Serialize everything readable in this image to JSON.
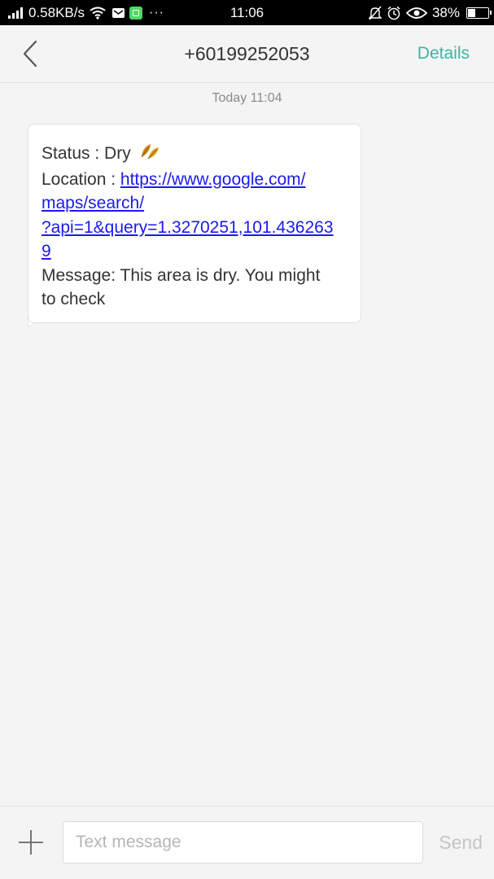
{
  "status_bar": {
    "network_speed": "0.58KB/s",
    "time": "11:06",
    "battery_percent": "38%",
    "battery_level": 0.38,
    "overflow": "···",
    "icons": [
      "signal-icon",
      "wifi-icon",
      "mail-icon",
      "app-notification-icon",
      "muted-bell-icon",
      "alarm-icon",
      "eye-icon",
      "battery-icon"
    ]
  },
  "header": {
    "title": "+60199252053",
    "details_label": "Details"
  },
  "conversation": {
    "timestamp": "Today  11:04",
    "message": {
      "status_label": "Status : Dry ",
      "status_emoji": "leaves",
      "location_label": "Location : ",
      "link_line1": "https://www.google.com/",
      "link_line2": "maps/search/",
      "link_line3": "?api=1&query=1.3270251,101.436263",
      "link_line4": "9",
      "message_line1": "Message: This area is dry. You might",
      "message_line2": "to check"
    }
  },
  "composer": {
    "placeholder": "Text message",
    "send_label": "Send"
  },
  "colors": {
    "accent": "#3db5a4",
    "link": "#1a1aee",
    "background": "#f4f4f4"
  }
}
